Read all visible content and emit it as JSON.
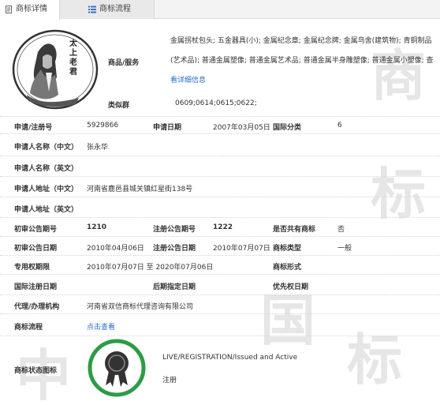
{
  "tabs": [
    {
      "label": "商标详情"
    },
    {
      "label": "商标流程"
    }
  ],
  "portrait": {
    "caption": "太上老君"
  },
  "goods": {
    "label": "商品/服务",
    "text": "金属拐杖包头; 五金器具(小); 金属纪念章; 金属纪念牌; 金属鸟舍(建筑物); 青铜制品(艺术品); 普通金属塑像; 普通金属艺术品; 普通金属半身雕塑像; 普通金属小塑像; 查",
    "more_link": "看详细信息"
  },
  "similar_group": {
    "label": "类似群",
    "value": "0609;0614;0615;0622;"
  },
  "fields": {
    "reg_no_label": "申请/注册号",
    "reg_no": "5929866",
    "app_date_label": "申请日期",
    "app_date": "2007年03月05日",
    "intl_class_label": "国际分类",
    "intl_class": "6",
    "applicant_cn_label": "申请人名称（中文）",
    "applicant_cn": "张永华",
    "applicant_en_label": "申请人名称（英文）",
    "address_cn_label": "申请人地址（中文）",
    "address_cn": "河南省鹿邑县城关镇红星街138号",
    "address_en_label": "申请人地址（英文）",
    "prelim_no_label": "初审公告期号",
    "prelim_no": "1210",
    "reg_pub_no_label": "注册公告期号",
    "reg_pub_no": "1222",
    "shared_label": "是否共有商标",
    "shared": "否",
    "prelim_date_label": "初审公告日期",
    "prelim_date": "2010年04月06日",
    "reg_pub_date_label": "注册公告日期",
    "reg_pub_date": "2010年07月07日",
    "type_label": "商标类型",
    "type": "一般",
    "exclusive_label": "专用权期限",
    "exclusive": "2010年07月07日 至 2020年07月06日",
    "form_label": "商标形式",
    "intl_reg_label": "国际注册日期",
    "later_label": "后期指定日期",
    "priority_label": "优先权日期",
    "agent_label": "代理/办理机构",
    "agent": "河南省双信商标代理咨询有限公司",
    "flow_label": "商标流程",
    "flow_link": "点击查看",
    "status_label": "商标状态图标",
    "status_en": "LIVE/REGISTRATION/Issued and Active",
    "status_cn": "注册"
  },
  "colors": {
    "link": "#2a6cc8",
    "badge_ring": "#2e9b45",
    "badge_body": "#333333"
  }
}
